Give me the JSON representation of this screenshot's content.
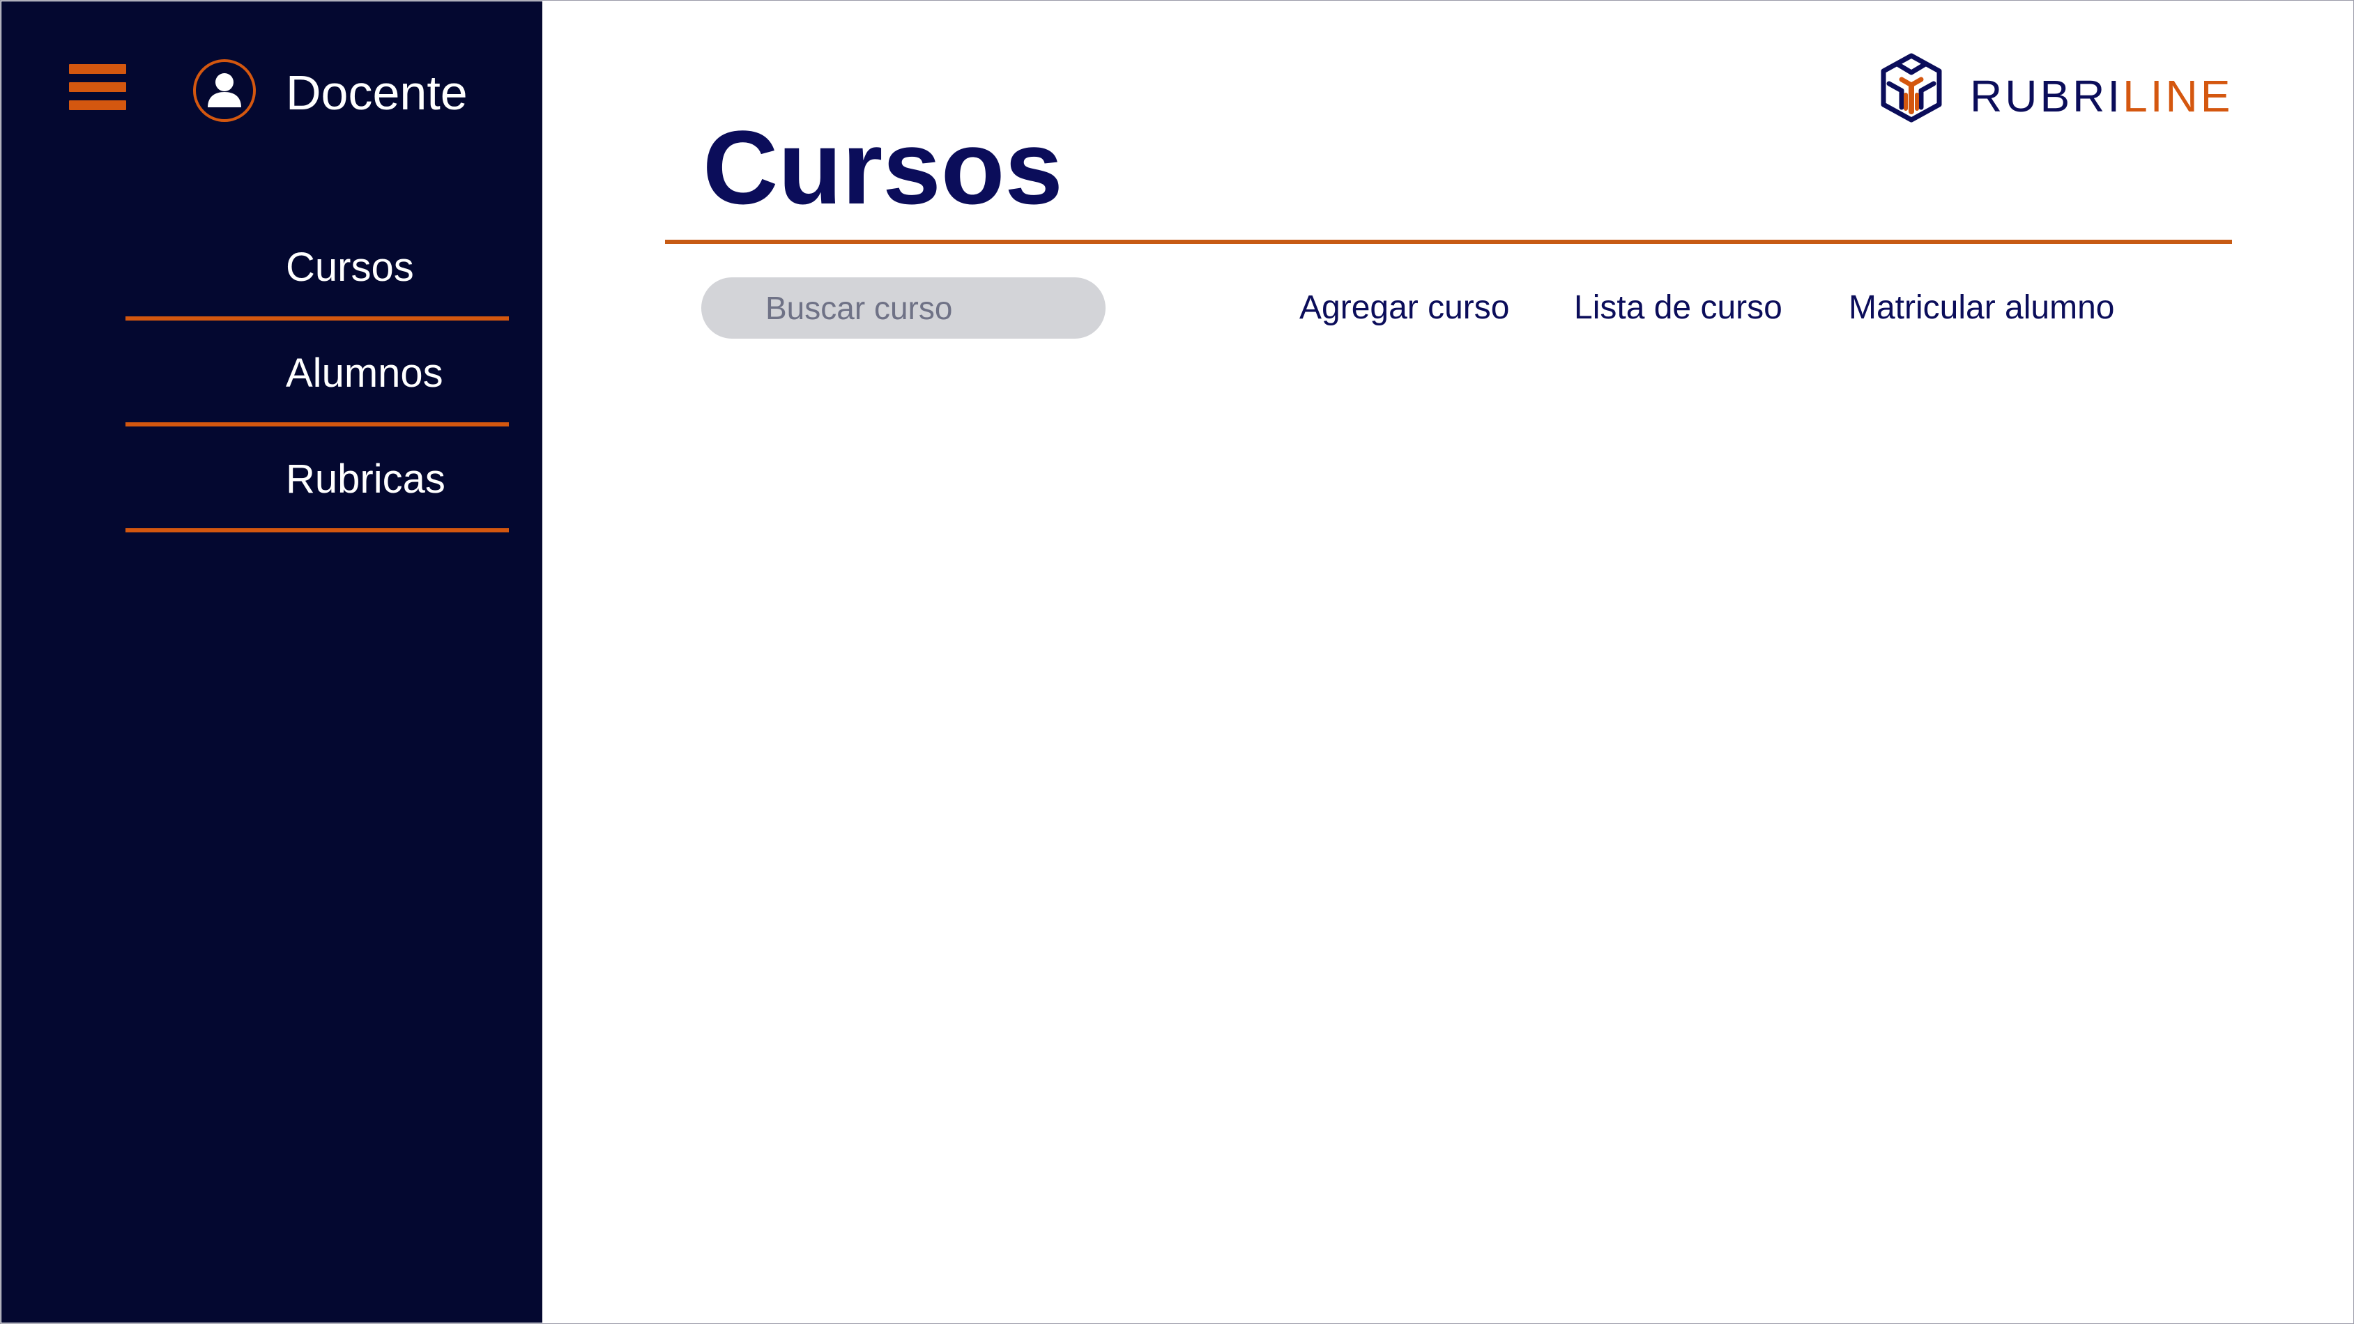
{
  "sidebar": {
    "role": "Docente",
    "items": [
      {
        "label": "Cursos"
      },
      {
        "label": "Alumnos"
      },
      {
        "label": "Rubricas"
      }
    ]
  },
  "logo": {
    "part1": "RUBRI",
    "part2": "LINE"
  },
  "main": {
    "title": "Cursos",
    "search": {
      "placeholder": "Buscar curso",
      "value": ""
    },
    "actions": [
      {
        "label": "Agregar curso"
      },
      {
        "label": "Lista de curso"
      },
      {
        "label": "Matricular alumno"
      }
    ]
  },
  "colors": {
    "sidebar_bg": "#040830",
    "accent_orange": "#d4570f",
    "brand_navy": "#0b0d5a",
    "search_bg": "#d3d4d8"
  },
  "icons": {
    "menu": "hamburger-menu-icon",
    "user": "user-avatar-icon",
    "logo": "rubriline-cube-logo-icon"
  }
}
